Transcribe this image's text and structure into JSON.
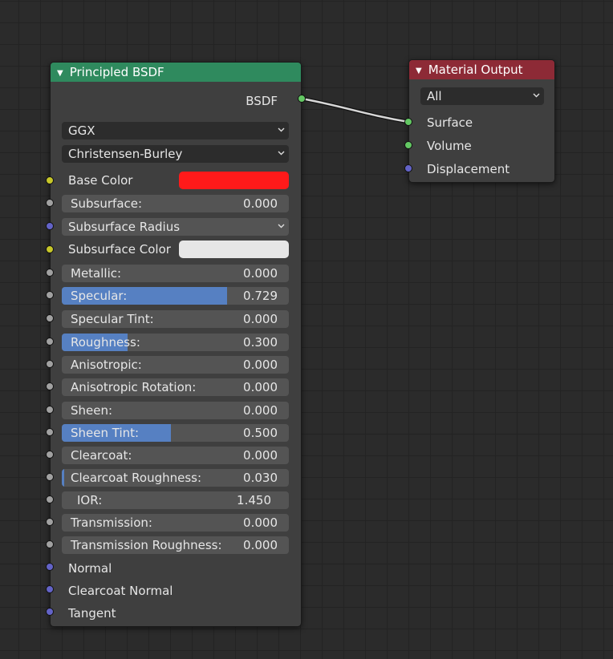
{
  "principled": {
    "title": "Principled BSDF",
    "header_color": "#2f8a5e",
    "output_label": "BSDF",
    "distribution": "GGX",
    "subsurface_method": "Christensen-Burley",
    "base_color_label": "Base Color",
    "base_color_value": "#ff1a1a",
    "subsurface": {
      "label": "Subsurface:",
      "value": "0.000",
      "fraction": 0
    },
    "subsurface_radius": "Subsurface Radius",
    "subsurface_color_label": "Subsurface Color",
    "subsurface_color_value": "#e6e6e6",
    "metallic": {
      "label": "Metallic:",
      "value": "0.000",
      "fraction": 0
    },
    "specular": {
      "label": "Specular:",
      "value": "0.729",
      "fraction": 0.729
    },
    "specular_tint": {
      "label": "Specular Tint:",
      "value": "0.000",
      "fraction": 0
    },
    "roughness": {
      "label": "Roughness:",
      "value": "0.300",
      "fraction": 0.3
    },
    "anisotropic": {
      "label": "Anisotropic:",
      "value": "0.000",
      "fraction": 0
    },
    "anisotropic_rotation": {
      "label": "Anisotropic Rotation:",
      "value": "0.000",
      "fraction": 0
    },
    "sheen": {
      "label": "Sheen:",
      "value": "0.000",
      "fraction": 0
    },
    "sheen_tint": {
      "label": "Sheen Tint:",
      "value": "0.500",
      "fraction": 0.5
    },
    "clearcoat": {
      "label": "Clearcoat:",
      "value": "0.000",
      "fraction": 0
    },
    "clearcoat_roughness": {
      "label": "Clearcoat Roughness:",
      "value": "0.030",
      "fraction": 0.03
    },
    "ior": {
      "label": "IOR:",
      "value": "1.450"
    },
    "transmission": {
      "label": "Transmission:",
      "value": "0.000",
      "fraction": 0
    },
    "transmission_roughness": {
      "label": "Transmission Roughness:",
      "value": "0.000",
      "fraction": 0
    },
    "normal": "Normal",
    "clearcoat_normal": "Clearcoat Normal",
    "tangent": "Tangent"
  },
  "material_output": {
    "title": "Material Output",
    "header_color": "#8d2a36",
    "target": "All",
    "inputs": {
      "surface": "Surface",
      "volume": "Volume",
      "displacement": "Displacement"
    }
  },
  "colors": {
    "accent": "#5680c2",
    "socket_shader": "#63c763",
    "socket_color": "#c7c729",
    "socket_float": "#a1a1a1",
    "socket_vector": "#6363c7"
  }
}
